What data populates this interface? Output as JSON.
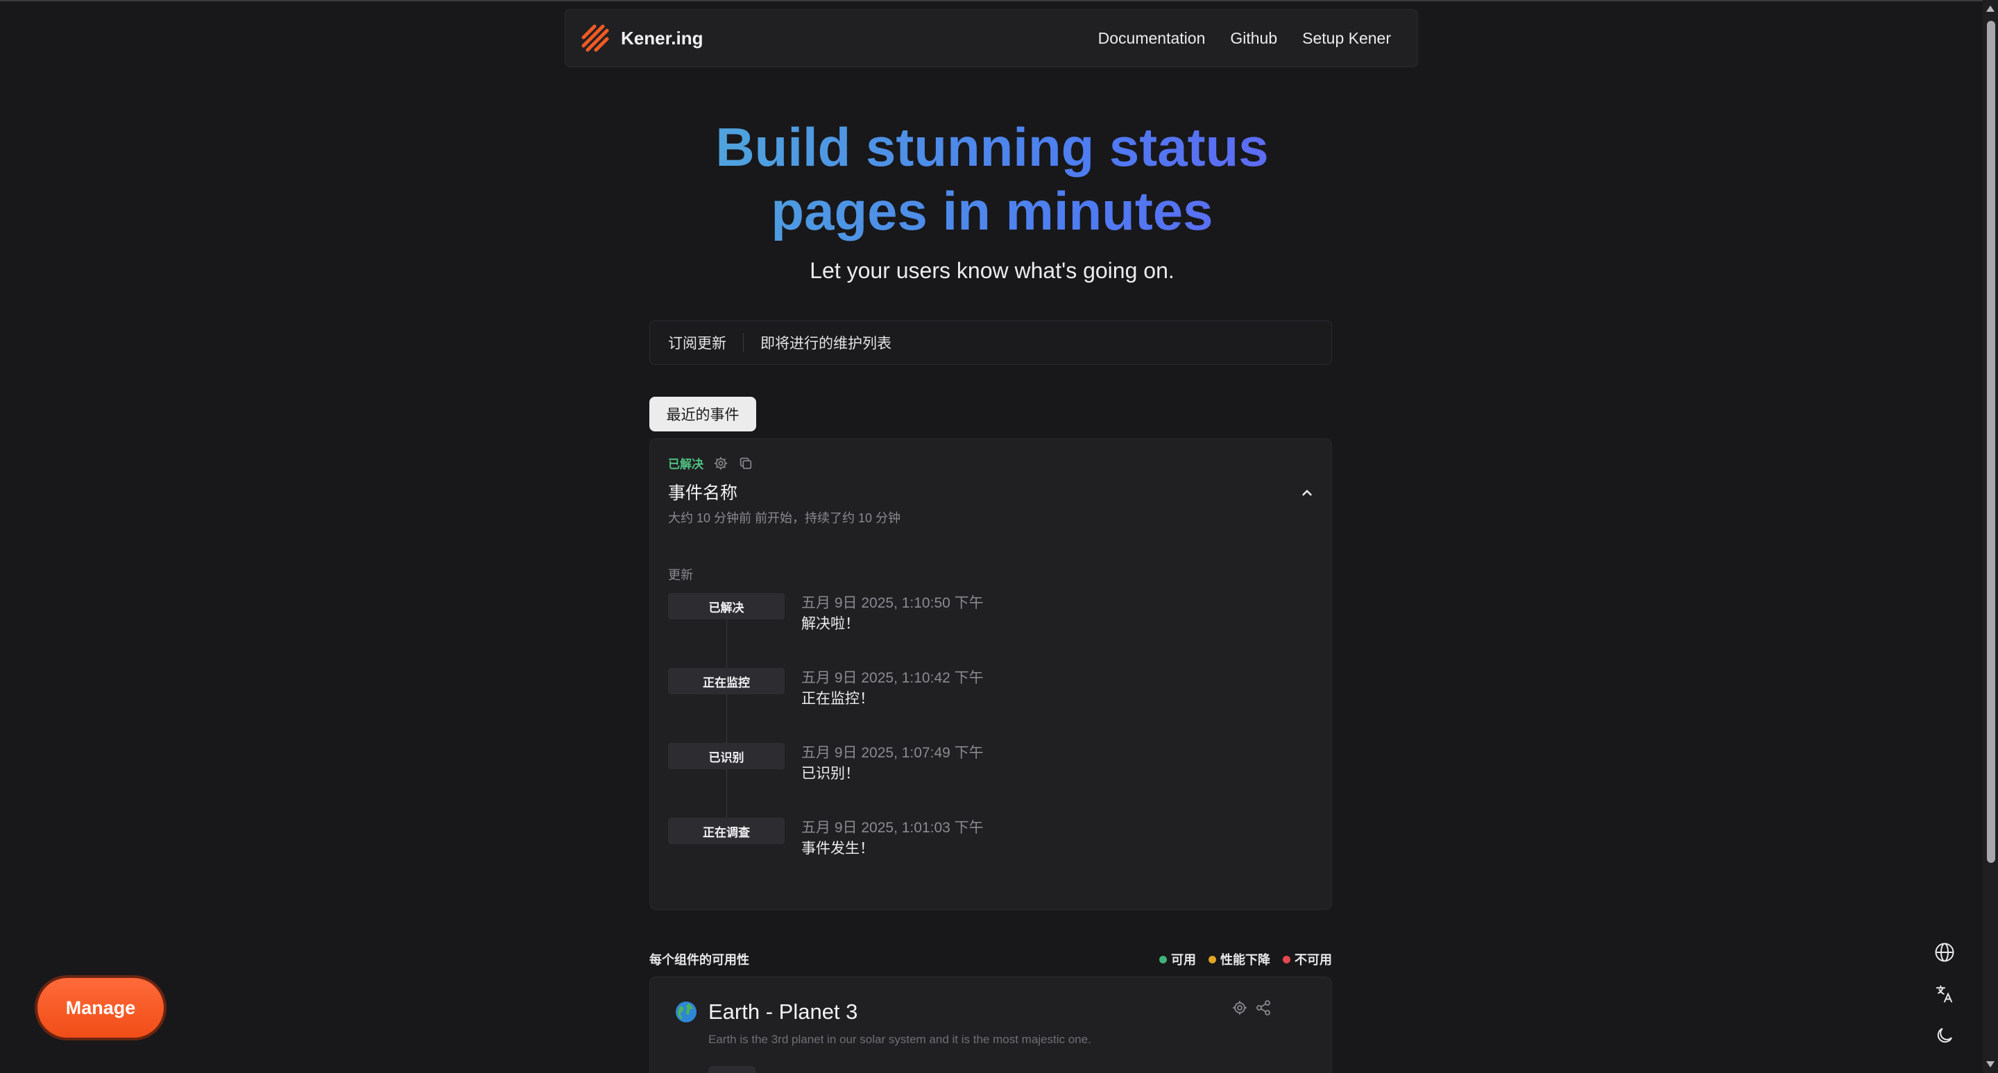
{
  "nav": {
    "brand": "Kener.ing",
    "links": [
      "Documentation",
      "Github",
      "Setup Kener"
    ]
  },
  "hero": {
    "title_line1": "Build stunning status",
    "title_line2": "pages in minutes",
    "subtitle": "Let your users know what's going on."
  },
  "subscribe_bar": {
    "subscribe": "订阅更新",
    "maintenance": "即将进行的维护列表"
  },
  "tabs": {
    "recent": "最近的事件"
  },
  "incident": {
    "status": "已解决",
    "title": "事件名称",
    "meta": "大约 10 分钟前 前开始，持续了约 10 分钟",
    "updates_label": "更新",
    "updates": [
      {
        "tag": "已解决",
        "time": "五月 9日 2025, 1:10:50 下午",
        "msg": "解决啦！"
      },
      {
        "tag": "正在监控",
        "time": "五月 9日 2025, 1:10:42 下午",
        "msg": "正在监控！"
      },
      {
        "tag": "已识别",
        "time": "五月 9日 2025, 1:07:49 下午",
        "msg": "已识别！"
      },
      {
        "tag": "正在调查",
        "time": "五月 9日 2025, 1:01:03 下午",
        "msg": "事件发生！"
      }
    ]
  },
  "availability": {
    "title": "每个组件的可用性",
    "legend": [
      {
        "label": "可用",
        "color": "#3fb37a"
      },
      {
        "label": "性能下降",
        "color": "#e0a526"
      },
      {
        "label": "不可用",
        "color": "#e5484d"
      }
    ]
  },
  "monitor": {
    "name": "Earth - Planet 3",
    "description": "Earth is the 3rd planet in our solar system and it is the most majestic one."
  },
  "manage": {
    "label": "Manage"
  },
  "colors": {
    "accent": "#f25a22",
    "success": "#4fc07f"
  }
}
